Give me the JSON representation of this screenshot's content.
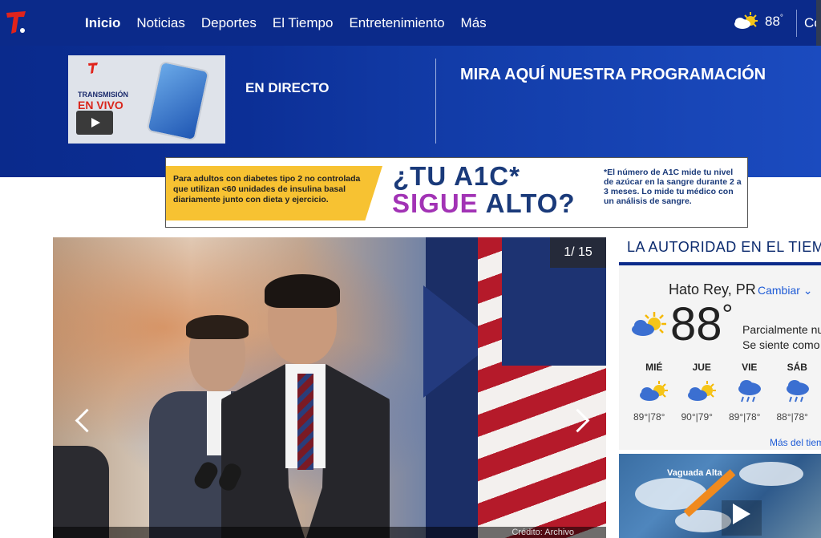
{
  "header": {
    "nav": [
      {
        "label": "Inicio",
        "active": true
      },
      {
        "label": "Noticias"
      },
      {
        "label": "Deportes"
      },
      {
        "label": "El Tiempo"
      },
      {
        "label": "Entretenimiento"
      },
      {
        "label": "Más"
      }
    ],
    "temp": "88",
    "deg": "°",
    "cutoff_text": "Co",
    "icons": {
      "logo": "telemundo-logo",
      "weather": "partly-sunny-icon"
    }
  },
  "banner": {
    "thumb_line1": "TRANSMISIÓN",
    "thumb_line2": "EN VIVO",
    "live_label": "EN DIRECTO",
    "programming_label": "MIRA AQUÍ NUESTRA PROGRAMACIÓN"
  },
  "ad": {
    "left_text": "Para adultos con diabetes tipo 2 no controlada que utilizan <60 unidades de insulina basal diariamente junto con dieta y ejercicio.",
    "headline_line1": "¿TU A1C*",
    "headline_purple": "SIGUE",
    "headline_blue": "ALTO?",
    "note": "*El número de A1C mide tu nivel de azúcar en la sangre durante 2 a 3 meses. Lo mide tu médico con un análisis de sangre."
  },
  "gallery": {
    "counter": "1/ 15",
    "credit": "Crédito: Archivo"
  },
  "weather": {
    "section_title": "LA AUTORIDAD EN EL TIEMPO",
    "location": "Hato Rey, PR",
    "change_label": "Cambiar",
    "temp": "88",
    "deg": "°",
    "condition": "Parcialmente nublado",
    "feels_like": "Se siente como",
    "forecast": [
      {
        "day": "MIÉ",
        "icon": "partly-sunny-icon",
        "hi": "89",
        "lo": "78"
      },
      {
        "day": "JUE",
        "icon": "partly-sunny-icon",
        "hi": "90",
        "lo": "79"
      },
      {
        "day": "VIE",
        "icon": "rain-icon",
        "hi": "89",
        "lo": "78"
      },
      {
        "day": "SÁB",
        "icon": "rain-icon",
        "hi": "88",
        "lo": "78"
      }
    ],
    "more_link": "Más del tiempo",
    "map_label": "Vaguada Alta"
  }
}
